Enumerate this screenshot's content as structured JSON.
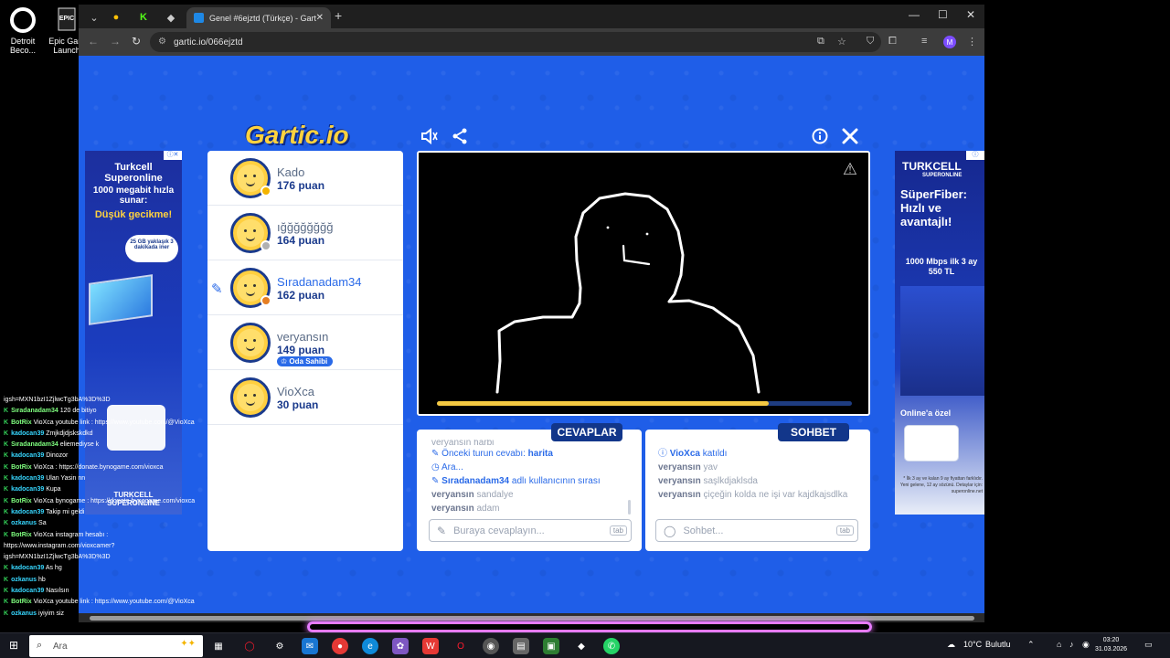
{
  "desktop": {
    "icons": [
      {
        "label": "Detroit Beco...",
        "icon": "detroit-icon"
      },
      {
        "label": "Epic Gam Launch",
        "icon": "epic-games-icon"
      }
    ]
  },
  "browser": {
    "tab_title": "Genel #6ejztd (Türkçe) - Gartic",
    "url": "gartic.io/066ejztd"
  },
  "game": {
    "logo": "Gartic.io",
    "players": [
      {
        "name": "Kado",
        "score": "176 puan",
        "status_color": "#f4b400"
      },
      {
        "name": "ığğğğğğğğ",
        "score": "164 puan",
        "status_color": "#b0b0b0"
      },
      {
        "name": "Sıradanadam34",
        "score": "162 puan",
        "status_color": "#e67e22",
        "drawing": true
      },
      {
        "name": "veryansın",
        "score": "149 puan",
        "badge": "Oda Sahibi"
      },
      {
        "name": "VioXca",
        "score": "30 puan"
      }
    ],
    "timer_progress": 0.8,
    "answers_tab": "CEVAPLAR",
    "chat_tab": "SOHBET",
    "answers": {
      "cut_top": "veryansın harbi",
      "prev_answer_label": "Önceki turun cevabı:",
      "prev_answer": "harita",
      "searching": "Ara...",
      "turn_user": "Sıradanadam34",
      "turn_suffix": "adlı kullanıcının sırası",
      "rows": [
        {
          "user": "veryansın",
          "text": "sandalye"
        },
        {
          "user": "veryansın",
          "text": "adam"
        }
      ],
      "placeholder": "Buraya cevaplayın...",
      "tab_key": "tab"
    },
    "chat": {
      "joined_user": "VioXca",
      "joined_text": "katıldı",
      "rows": [
        {
          "user": "veryansın",
          "text": "yav"
        },
        {
          "user": "veryansın",
          "text": "saşlkdjaklsda"
        },
        {
          "user": "veryansın",
          "text": "çiçeğin kolda ne işi var kajdkajsdlka"
        }
      ],
      "placeholder": "Sohbet...",
      "tab_key": "tab"
    }
  },
  "ads": {
    "left": {
      "brand": "Turkcell Superonline",
      "line1": "1000 megabit hızla sunar:",
      "highlight": "Düşük gecikme!",
      "bubble": "25 GB yaklaşık 3 dakikada iner",
      "footer": "TURKCELL SUPERONLINE"
    },
    "right": {
      "brand": "TURKCELL",
      "sub": "SUPERONLINE",
      "headline": "SüperFiber: Hızlı ve avantajlı!",
      "offer": "1000 Mbps ilk 3 ay 550 TL",
      "badge": "Online'a özel",
      "fine": "* İlk 3 ay ve kalan 9 ay fiyattan farklıdır. Yeni gelene, 12 ay sözünü. Detaylar için: superonline.net"
    }
  },
  "overlay_chat": [
    {
      "user": "",
      "text": "igsh=MXN1bzI1ZjlwcTg3bA%3D%3D",
      "plain": true
    },
    {
      "user": "Sıradanadam34",
      "text": "120 de bitiyo",
      "cls": "u2"
    },
    {
      "user": "BotRix",
      "text": "VioXca youtube link : https://www.youtube.com/@VioXca",
      "cls": "u2"
    },
    {
      "user": "kadocan39",
      "text": "Zmjkdjdjskskdkd",
      "cls": "u1"
    },
    {
      "user": "Sıradanadam34",
      "text": "eliemediyse k",
      "cls": "u2"
    },
    {
      "user": "kadocan39",
      "text": "Dinozor",
      "cls": "u1"
    },
    {
      "user": "BotRix",
      "text": "VioXca : https://donate.bynogame.com/vioxca",
      "cls": "u2"
    },
    {
      "user": "kadocan39",
      "text": "Ulan Yasin nn",
      "cls": "u1"
    },
    {
      "user": "kadocan39",
      "text": "Kupa",
      "cls": "u1"
    },
    {
      "user": "BotRix",
      "text": "VioXca bynogame : https://donate.bynogame.com/vioxca",
      "cls": "u2"
    },
    {
      "user": "kadocan39",
      "text": "Takip mi geldi",
      "cls": "u1"
    },
    {
      "user": "ozkanus",
      "text": "Sa",
      "cls": "u1"
    },
    {
      "user": "BotRix",
      "text": "VioXca instagram hesabı :",
      "cls": "u2"
    },
    {
      "user": "",
      "text": "https://www.instagram.com/vioxcamer?",
      "plain": true
    },
    {
      "user": "",
      "text": "igsh=MXN1bzI1ZjlwcTg3bA%3D%3D",
      "plain": true
    },
    {
      "user": "kadocan39",
      "text": "As hg",
      "cls": "u1"
    },
    {
      "user": "ozkanus",
      "text": "hb",
      "cls": "u1"
    },
    {
      "user": "kadocan39",
      "text": "Nasılsın",
      "cls": "u1"
    },
    {
      "user": "BotRix",
      "text": "VioXca youtube link : https://www.youtube.com/@VioXca",
      "cls": "u2"
    },
    {
      "user": "ozkanus",
      "text": "iyiyim siz",
      "cls": "u1"
    }
  ],
  "taskbar": {
    "search_placeholder": "Ara",
    "weather": "10°C",
    "weather_text": "Bulutlu",
    "time": "03:20",
    "date": "31.03.2026"
  },
  "colors": {
    "page_bg": "#1f5ee8",
    "accent_blue": "#2a6ae8",
    "tab_pill": "#12368a",
    "logo_yellow": "#ffd23f"
  }
}
